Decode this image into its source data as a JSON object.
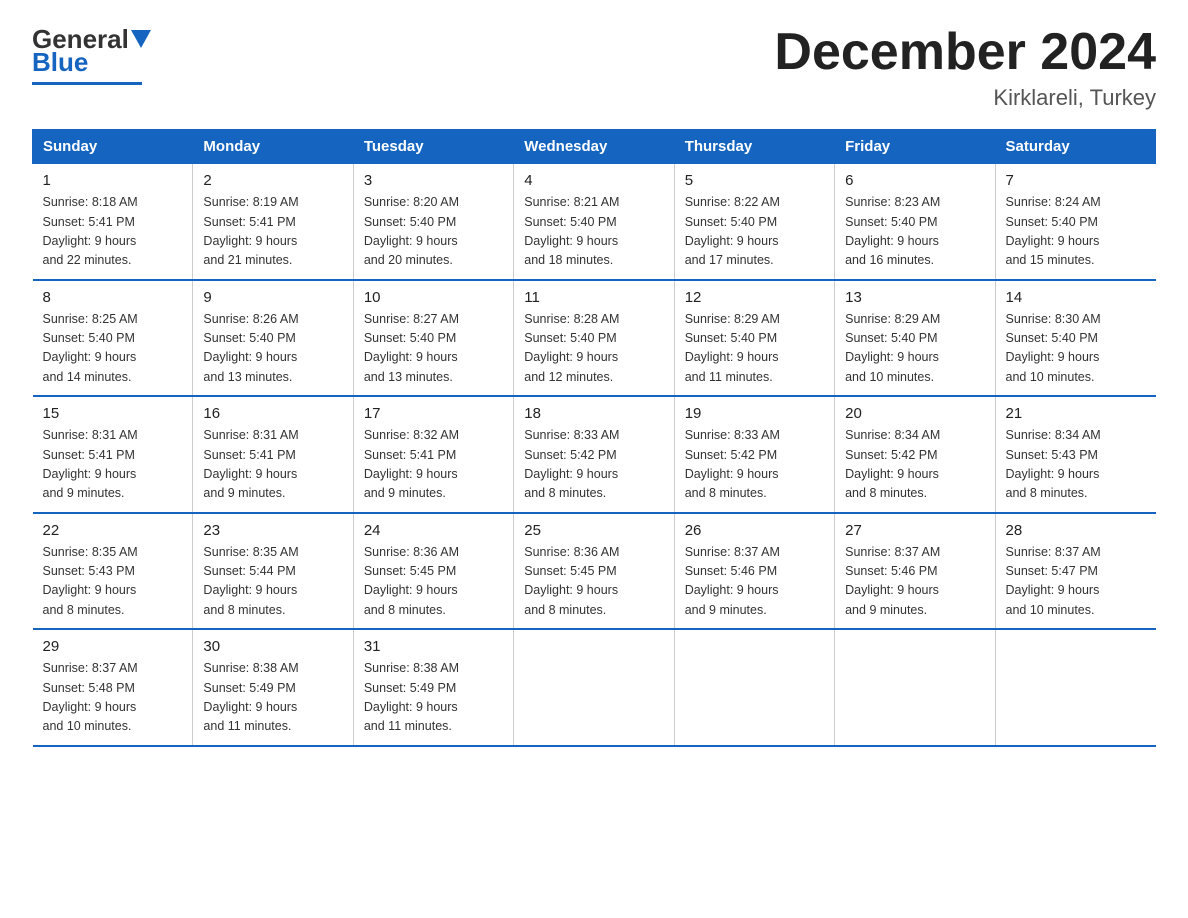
{
  "logo": {
    "general": "General",
    "blue": "Blue"
  },
  "title": "December 2024",
  "subtitle": "Kirklareli, Turkey",
  "days_of_week": [
    "Sunday",
    "Monday",
    "Tuesday",
    "Wednesday",
    "Thursday",
    "Friday",
    "Saturday"
  ],
  "weeks": [
    [
      {
        "day": "1",
        "sunrise": "8:18 AM",
        "sunset": "5:41 PM",
        "daylight": "9 hours and 22 minutes."
      },
      {
        "day": "2",
        "sunrise": "8:19 AM",
        "sunset": "5:41 PM",
        "daylight": "9 hours and 21 minutes."
      },
      {
        "day": "3",
        "sunrise": "8:20 AM",
        "sunset": "5:40 PM",
        "daylight": "9 hours and 20 minutes."
      },
      {
        "day": "4",
        "sunrise": "8:21 AM",
        "sunset": "5:40 PM",
        "daylight": "9 hours and 18 minutes."
      },
      {
        "day": "5",
        "sunrise": "8:22 AM",
        "sunset": "5:40 PM",
        "daylight": "9 hours and 17 minutes."
      },
      {
        "day": "6",
        "sunrise": "8:23 AM",
        "sunset": "5:40 PM",
        "daylight": "9 hours and 16 minutes."
      },
      {
        "day": "7",
        "sunrise": "8:24 AM",
        "sunset": "5:40 PM",
        "daylight": "9 hours and 15 minutes."
      }
    ],
    [
      {
        "day": "8",
        "sunrise": "8:25 AM",
        "sunset": "5:40 PM",
        "daylight": "9 hours and 14 minutes."
      },
      {
        "day": "9",
        "sunrise": "8:26 AM",
        "sunset": "5:40 PM",
        "daylight": "9 hours and 13 minutes."
      },
      {
        "day": "10",
        "sunrise": "8:27 AM",
        "sunset": "5:40 PM",
        "daylight": "9 hours and 13 minutes."
      },
      {
        "day": "11",
        "sunrise": "8:28 AM",
        "sunset": "5:40 PM",
        "daylight": "9 hours and 12 minutes."
      },
      {
        "day": "12",
        "sunrise": "8:29 AM",
        "sunset": "5:40 PM",
        "daylight": "9 hours and 11 minutes."
      },
      {
        "day": "13",
        "sunrise": "8:29 AM",
        "sunset": "5:40 PM",
        "daylight": "9 hours and 10 minutes."
      },
      {
        "day": "14",
        "sunrise": "8:30 AM",
        "sunset": "5:40 PM",
        "daylight": "9 hours and 10 minutes."
      }
    ],
    [
      {
        "day": "15",
        "sunrise": "8:31 AM",
        "sunset": "5:41 PM",
        "daylight": "9 hours and 9 minutes."
      },
      {
        "day": "16",
        "sunrise": "8:31 AM",
        "sunset": "5:41 PM",
        "daylight": "9 hours and 9 minutes."
      },
      {
        "day": "17",
        "sunrise": "8:32 AM",
        "sunset": "5:41 PM",
        "daylight": "9 hours and 9 minutes."
      },
      {
        "day": "18",
        "sunrise": "8:33 AM",
        "sunset": "5:42 PM",
        "daylight": "9 hours and 8 minutes."
      },
      {
        "day": "19",
        "sunrise": "8:33 AM",
        "sunset": "5:42 PM",
        "daylight": "9 hours and 8 minutes."
      },
      {
        "day": "20",
        "sunrise": "8:34 AM",
        "sunset": "5:42 PM",
        "daylight": "9 hours and 8 minutes."
      },
      {
        "day": "21",
        "sunrise": "8:34 AM",
        "sunset": "5:43 PM",
        "daylight": "9 hours and 8 minutes."
      }
    ],
    [
      {
        "day": "22",
        "sunrise": "8:35 AM",
        "sunset": "5:43 PM",
        "daylight": "9 hours and 8 minutes."
      },
      {
        "day": "23",
        "sunrise": "8:35 AM",
        "sunset": "5:44 PM",
        "daylight": "9 hours and 8 minutes."
      },
      {
        "day": "24",
        "sunrise": "8:36 AM",
        "sunset": "5:45 PM",
        "daylight": "9 hours and 8 minutes."
      },
      {
        "day": "25",
        "sunrise": "8:36 AM",
        "sunset": "5:45 PM",
        "daylight": "9 hours and 8 minutes."
      },
      {
        "day": "26",
        "sunrise": "8:37 AM",
        "sunset": "5:46 PM",
        "daylight": "9 hours and 9 minutes."
      },
      {
        "day": "27",
        "sunrise": "8:37 AM",
        "sunset": "5:46 PM",
        "daylight": "9 hours and 9 minutes."
      },
      {
        "day": "28",
        "sunrise": "8:37 AM",
        "sunset": "5:47 PM",
        "daylight": "9 hours and 10 minutes."
      }
    ],
    [
      {
        "day": "29",
        "sunrise": "8:37 AM",
        "sunset": "5:48 PM",
        "daylight": "9 hours and 10 minutes."
      },
      {
        "day": "30",
        "sunrise": "8:38 AM",
        "sunset": "5:49 PM",
        "daylight": "9 hours and 11 minutes."
      },
      {
        "day": "31",
        "sunrise": "8:38 AM",
        "sunset": "5:49 PM",
        "daylight": "9 hours and 11 minutes."
      },
      null,
      null,
      null,
      null
    ]
  ],
  "labels": {
    "sunrise": "Sunrise:",
    "sunset": "Sunset:",
    "daylight": "Daylight:"
  }
}
